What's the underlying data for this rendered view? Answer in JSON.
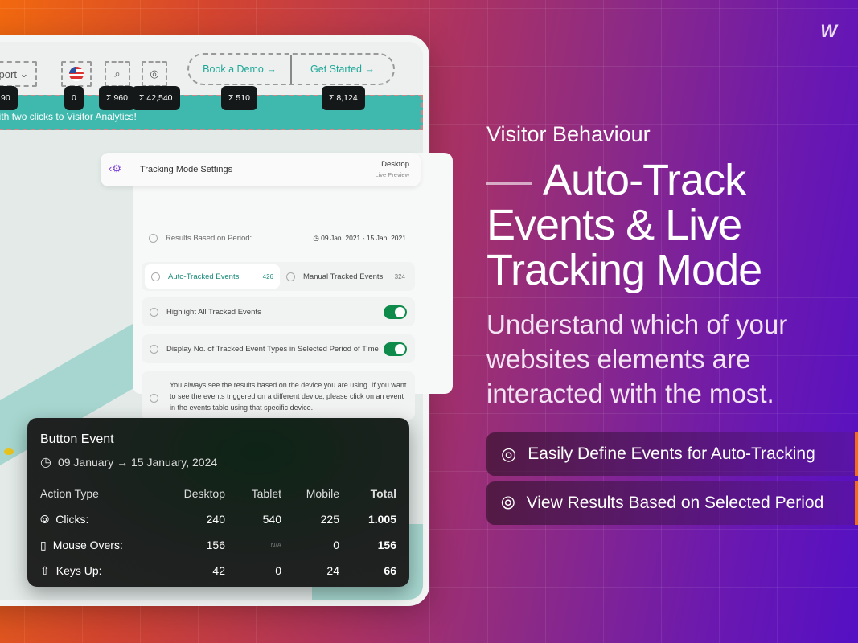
{
  "brand": {
    "logo": "W"
  },
  "topbar": {
    "support_label": "port",
    "badges": [
      "90",
      "0",
      "Σ 960",
      "Σ 42,540",
      "Σ 510",
      "Σ 8,124"
    ],
    "book_demo": "Book a Demo →",
    "get_started": "Get Started →",
    "banner_text": "ata with two clicks to Visitor Analytics!"
  },
  "settings": {
    "title": "Tracking Mode Settings",
    "device": "Desktop",
    "preview": "Live Preview",
    "period_label": "Results Based on Period:",
    "period_value": "09 Jan. 2021 - 15 Jan. 2021",
    "tabs": [
      {
        "label": "Auto-Tracked Events",
        "count": "426",
        "active": true
      },
      {
        "label": "Manual Tracked Events",
        "count": "324",
        "active": false
      }
    ],
    "toggles": [
      {
        "label": "Highlight All Tracked Events",
        "on": true
      },
      {
        "label": "Display No. of Tracked Event Types in Selected Period of Time",
        "on": true
      }
    ],
    "note": "You always see the results based on the device you are using. If you want to see the events triggered on a different device, please click on an event in the events table using that specific device."
  },
  "tooltip": {
    "title": "Button Event",
    "date": "09 January → 15 January, 2024",
    "headers": [
      "Action Type",
      "Desktop",
      "Tablet",
      "Mobile",
      "Total"
    ],
    "rows": [
      {
        "icon": "click-icon",
        "label": "Clicks:",
        "values": [
          "240",
          "540",
          "225",
          "1.005"
        ]
      },
      {
        "icon": "mouse-icon",
        "label": "Mouse Overs:",
        "values": [
          "156",
          "N/A",
          "0",
          "156"
        ]
      },
      {
        "icon": "arrow-up-circle-icon",
        "label": "Keys Up:",
        "values": [
          "42",
          "0",
          "24",
          "66"
        ]
      }
    ]
  },
  "hero": {
    "eyebrow": "Visitor Behaviour",
    "title_line1": "Auto-Track",
    "title_line2": "Events & Live",
    "title_line3": "Tracking Mode",
    "description": "Understand which of your websites elements are interacted with the most."
  },
  "features": [
    {
      "icon": "target-icon",
      "label": "Easily Define Events for Auto-Tracking"
    },
    {
      "icon": "click-icon",
      "label": "View Results Based on Selected Period"
    }
  ],
  "colors": {
    "accent_teal": "#1fa897",
    "toggle_green": "#0e8a4a",
    "orange": "#f26b1a",
    "purple": "#5510c4"
  }
}
